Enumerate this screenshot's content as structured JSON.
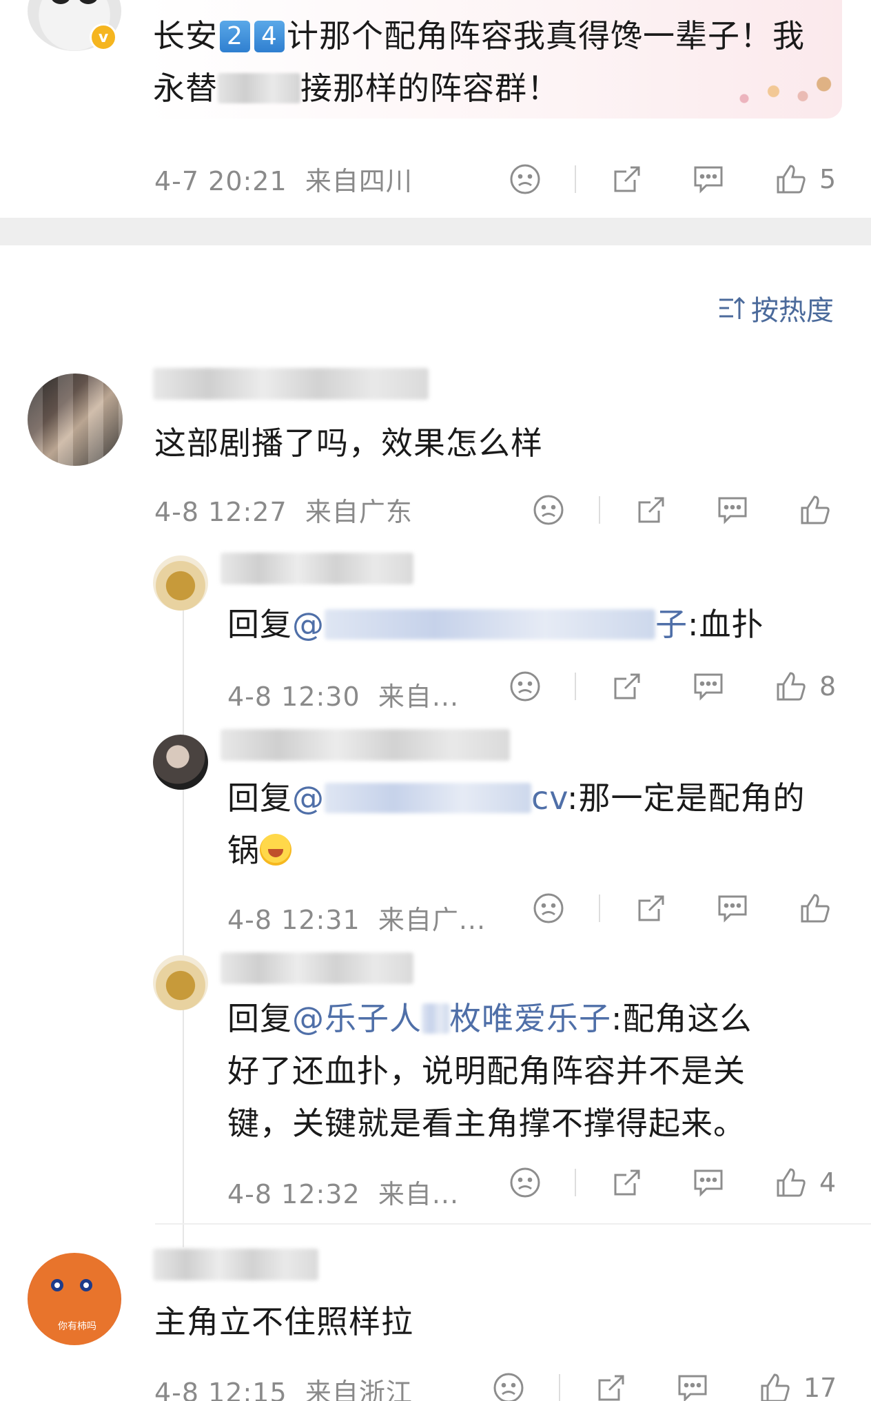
{
  "top_post": {
    "text_before": "长安",
    "key1": "2",
    "key2": "4",
    "text_mid": "计那个配角阵容我真得馋一辈子！我永替",
    "text_after": "接那样的阵容群！",
    "time": "4-7 20:21",
    "location": "来自四川",
    "likes": "5"
  },
  "sort_label": "按热度",
  "comments": [
    {
      "text": "这部剧播了吗，效果怎么样",
      "time": "4-8 12:27",
      "location": "来自广东",
      "likes": ""
    },
    {
      "reply_prefix": "回复",
      "mention_at": "@",
      "mention_tail": "子",
      "text": ":血扑",
      "time": "4-8 12:30",
      "location": "来自...",
      "likes": "8"
    },
    {
      "reply_prefix": "回复",
      "mention_at": "@",
      "mention_tail": "cv",
      "text_line1": ":那一定是配角的",
      "text_line2": "锅",
      "time": "4-8 12:31",
      "location": "来自广...",
      "likes": ""
    },
    {
      "reply_prefix": "回复",
      "mention_at": "@乐子人",
      "mention_tail": "枚唯爱乐子",
      "text_line1": ":配角这么",
      "text_line2": "好了还血扑，说明配角阵容并不是关",
      "text_line3": "键，关键就是看主角撑不撑得起来。",
      "time": "4-8 12:32",
      "location": "来自...",
      "likes": "4"
    },
    {
      "text": "主角立不住照样拉",
      "time": "4-8 12:15",
      "location": "来自浙江",
      "likes": "17",
      "avatar_caption": "你有柿吗"
    }
  ],
  "icons": [
    "sad-face-icon",
    "share-icon",
    "comment-icon",
    "like-icon",
    "sort-icon",
    "verified-badge-icon"
  ],
  "colors": {
    "link": "#4f6fa8",
    "meta": "#8a8a8a",
    "sort": "#4b6a9b",
    "verified": "#f5b51f"
  }
}
